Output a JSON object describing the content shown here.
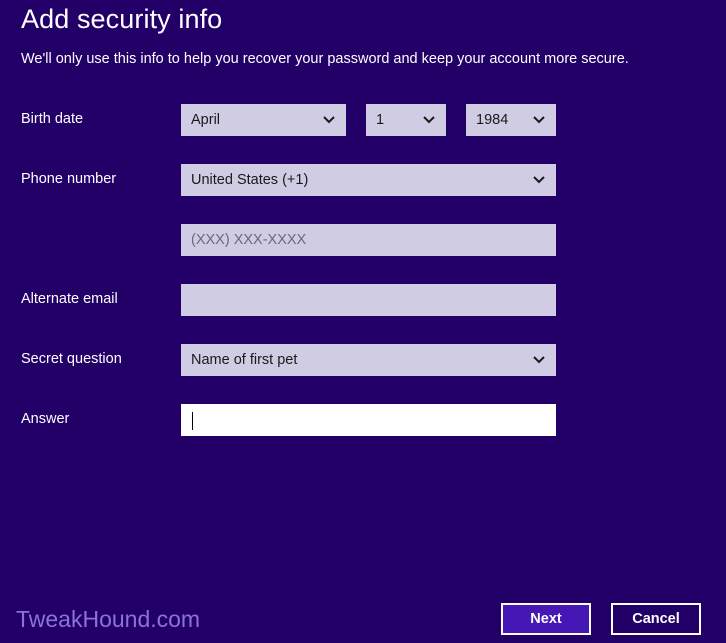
{
  "header": {
    "title": "Add security info",
    "subtitle": "We'll only use this info to help you recover your password and keep your account more secure."
  },
  "form": {
    "birth_date": {
      "label": "Birth date",
      "month": "April",
      "day": "1",
      "year": "1984"
    },
    "phone": {
      "label": "Phone number",
      "country": "United States (+1)",
      "number_value": "",
      "number_placeholder": "(XXX) XXX-XXXX"
    },
    "alternate_email": {
      "label": "Alternate email",
      "value": ""
    },
    "secret_question": {
      "label": "Secret question",
      "value": "Name of first pet"
    },
    "answer": {
      "label": "Answer",
      "value": ""
    }
  },
  "buttons": {
    "next": "Next",
    "cancel": "Cancel"
  },
  "watermark": "TweakHound.com",
  "colors": {
    "background": "#220068",
    "field": "#d0cce4",
    "next_button": "#4617b4",
    "watermark": "#8a74d6"
  },
  "icons": {
    "dropdown": "chevron-down-icon"
  }
}
